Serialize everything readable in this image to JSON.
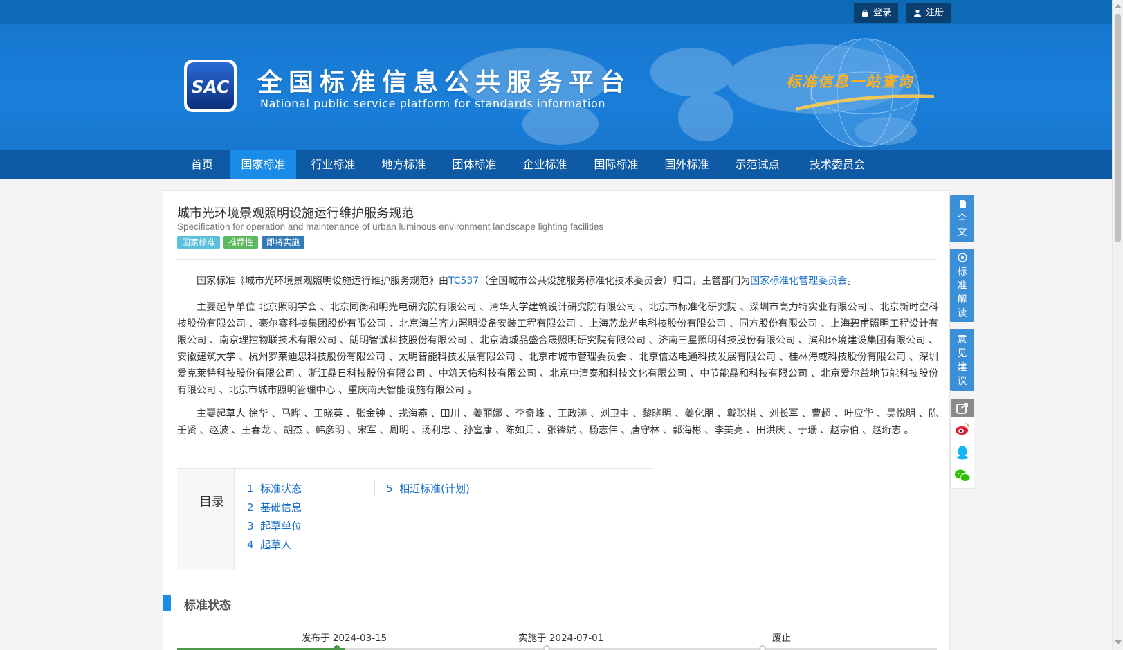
{
  "header": {
    "login_label": "登录",
    "register_label": "注册",
    "logo_text": "SAC",
    "site_title_cn": "全国标准信息公共服务平台",
    "site_title_en": "National public service platform  for standards information",
    "slogan": "标准信息一站查询"
  },
  "nav": {
    "items": [
      {
        "label": "首页"
      },
      {
        "label": "国家标准"
      },
      {
        "label": "行业标准"
      },
      {
        "label": "地方标准"
      },
      {
        "label": "团体标准"
      },
      {
        "label": "企业标准"
      },
      {
        "label": "国际标准"
      },
      {
        "label": "国外标准"
      },
      {
        "label": "示范试点"
      },
      {
        "label": "技术委员会"
      }
    ],
    "active": "国家标准"
  },
  "standard": {
    "title_cn": "城市光环境景观照明设施运行维护服务规范",
    "title_en": "Specification for operation and maintenance of urban luminous environment landscape lighting facilities",
    "tags": [
      {
        "label": "国家标准",
        "color": "#5bc0de"
      },
      {
        "label": "推荐性",
        "color": "#5cb85c"
      },
      {
        "label": "即将实施",
        "color": "#337ab7"
      }
    ],
    "intro_prefix": "国家标准《城市光环境景观照明设施运行维护服务规范》由",
    "intro_tc": "TC537",
    "intro_mid": "（全国城市公共设施服务标准化技术委员会）归口，主管部门为",
    "intro_dept": "国家标准化管理委员会",
    "intro_suffix": "。",
    "drafting_units": "主要起草单位 北京照明学会 、北京同衡和明光电研究院有限公司 、清华大学建筑设计研究院有限公司 、北京市标准化研究院 、深圳市高力特实业有限公司 、北京新时空科技股份有限公司 、豪尔赛科技集团股份有限公司 、北京海兰齐力照明设备安装工程有限公司 、上海芯龙光电科技股份有限公司 、同方股份有限公司 、上海碧甫照明工程设计有限公司 、南京理控物联技术有限公司 、朗明智诚科技股份有限公司 、北京清城品盛合晟照明研究院有限公司 、济南三星照明科技股份有限公司 、滨和环境建设集团有限公司 、安徽建筑大学 、杭州罗莱迪思科技股份有限公司 、太明智能科技发展有限公司 、北京市城市管理委员会 、北京信达电通科技发展有限公司 、桂林海威科技股份有限公司 、深圳爱克莱特科技股份有限公司 、浙江晶日科技股份有限公司 、中筑天佑科技有限公司 、北京中清泰和科技文化有限公司 、中节能晶和科技有限公司 、北京爱尔益地节能科技股份有限公司 、北京市城市照明管理中心 、重庆南天智能设施有限公司 。",
    "drafters": "主要起草人 徐华 、马晔 、王晓英 、张金钟 、戎海燕 、田川 、姜丽娜 、李奇峰 、王政涛 、刘卫中 、黎晓明 、姜化朋 、戴聪棋 、刘长军 、曹超 、叶应华 、吴悦明 、陈壬贤 、赵波 、王春龙 、胡杰 、韩彦明 、宋军 、周明 、汤利忠 、孙富康 、陈如兵 、张锋斌 、杨志伟 、唐守林 、郭海彬 、李美亮 、田洪庆 、于珊 、赵宗伯 、赵珩志 。"
  },
  "toc": {
    "label": "目录",
    "items": [
      {
        "num": "1",
        "label": "标准状态"
      },
      {
        "num": "2",
        "label": "基础信息"
      },
      {
        "num": "3",
        "label": "起草单位"
      },
      {
        "num": "4",
        "label": "起草人"
      },
      {
        "num": "5",
        "label": "相近标准(计划)"
      }
    ]
  },
  "status_section": {
    "title": "标准状态",
    "published": "发布于 2024-03-15",
    "implemented": "实施于 2024-07-01",
    "abolished": "废止",
    "progress_fraction": 0.22
  },
  "side": {
    "fulltext": [
      "全",
      "文"
    ],
    "interpretation": [
      "标",
      "准",
      "解",
      "读"
    ],
    "feedback": [
      "意",
      "见",
      "建",
      "议"
    ]
  }
}
